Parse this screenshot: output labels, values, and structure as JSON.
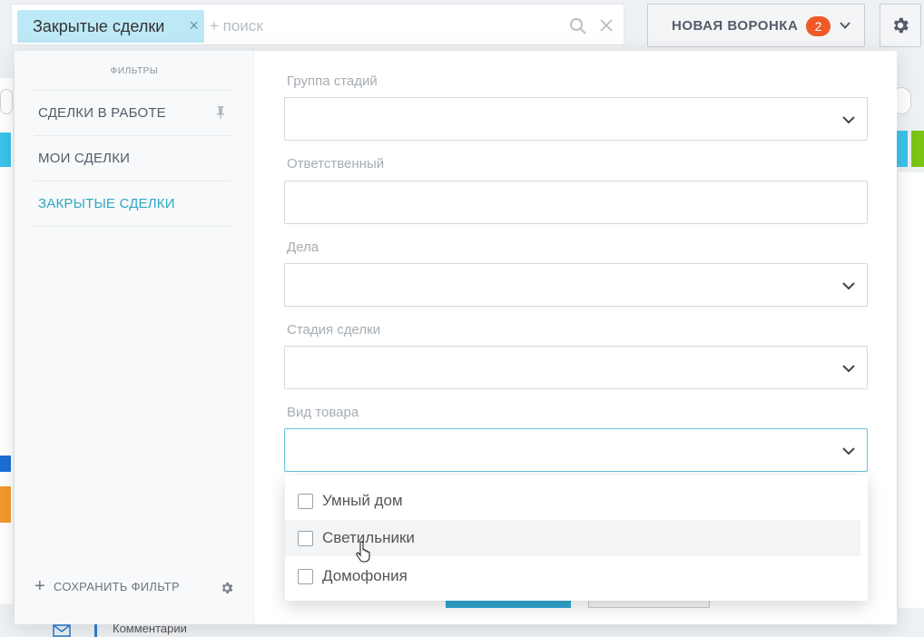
{
  "search": {
    "tag_label": "Закрытые сделки",
    "add_label": "+ поиск"
  },
  "funnel_button": {
    "label": "НОВАЯ ВОРОНКА",
    "badge_count": "2"
  },
  "sidebar": {
    "title": "ФИЛЬТРЫ",
    "items": [
      {
        "label": "СДЕЛКИ В РАБОТЕ",
        "pinned": true
      },
      {
        "label": "МОИ СДЕЛКИ"
      },
      {
        "label": "ЗАКРЫТЫЕ СДЕЛКИ",
        "active": true
      }
    ],
    "save_filter_label": "СОХРАНИТЬ ФИЛЬТР"
  },
  "fields": [
    {
      "label": "Группа стадий",
      "type": "select"
    },
    {
      "label": "Ответственный",
      "type": "input"
    },
    {
      "label": "Дела",
      "type": "select"
    },
    {
      "label": "Стадия сделки",
      "type": "select"
    },
    {
      "label": "Вид товара",
      "type": "select",
      "open": true
    }
  ],
  "dropdown_options": [
    {
      "label": "Умный дом"
    },
    {
      "label": "Светильники",
      "hover": true
    },
    {
      "label": "Домофония"
    }
  ],
  "background": {
    "comment_label": "Комментарии"
  },
  "colors": {
    "accent": "#2fa8c4",
    "badge": "#ef5a28",
    "tag_bg": "#bde9f7"
  }
}
